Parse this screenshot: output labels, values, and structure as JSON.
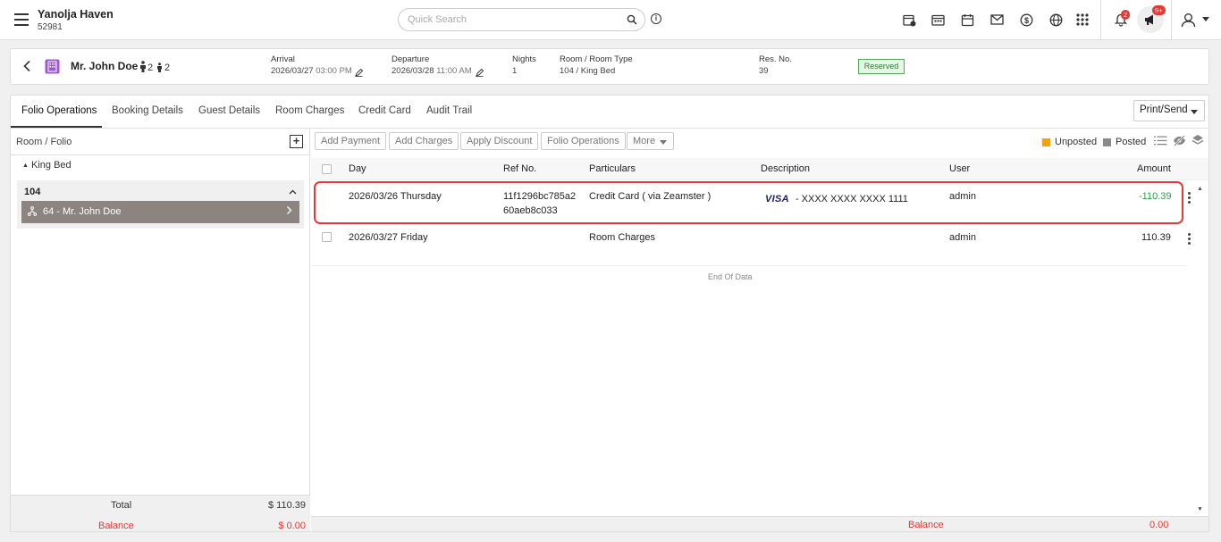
{
  "header": {
    "hotel_name": "Yanolja Haven",
    "hotel_id": "52981",
    "search_placeholder": "Quick Search",
    "notifications_badge": "2",
    "announcements_badge": "9+"
  },
  "reservation": {
    "guest_name": "Mr. John Doe",
    "adults": "2",
    "children": "2",
    "arrival_label": "Arrival",
    "arrival_date": "2026/03/27",
    "arrival_time": "03:00 PM",
    "departure_label": "Departure",
    "departure_date": "2026/03/28",
    "departure_time": "11:00 AM",
    "nights_label": "Nights",
    "nights": "1",
    "room_label": "Room / Room Type",
    "room_value": "104 / King Bed",
    "resno_label": "Res. No.",
    "resno": "39",
    "status": "Reserved"
  },
  "tabs": [
    "Folio Operations",
    "Booking Details",
    "Guest Details",
    "Room Charges",
    "Credit Card",
    "Audit Trail"
  ],
  "print_send": "Print/Send",
  "left": {
    "header": "Room / Folio",
    "group": "King Bed",
    "room": "104",
    "folio": "64 - Mr. John Doe",
    "total_label": "Total",
    "total_value": "$ 110.39",
    "balance_label": "Balance",
    "balance_value": "$ 0.00"
  },
  "actions": [
    "Add Payment",
    "Add Charges",
    "Apply Discount",
    "Folio Operations",
    "More"
  ],
  "legend": {
    "unposted": "Unposted",
    "posted": "Posted",
    "unposted_color": "#f0a30a",
    "posted_color": "#8a8a8a"
  },
  "columns": [
    "Day",
    "Ref No.",
    "Particulars",
    "Description",
    "User",
    "Amount"
  ],
  "rows": [
    {
      "day": "2026/03/26 Thursday",
      "ref1": "11f1296bc785a2",
      "ref2": "60aeb8c033",
      "particulars": "Credit Card ( via Zeamster )",
      "card_brand": "VISA",
      "description": "- XXXX XXXX XXXX 1111",
      "user": "admin",
      "amount": "-110.39"
    },
    {
      "day": "2026/03/27 Friday",
      "particulars": "Room Charges",
      "user": "admin",
      "amount": "110.39"
    }
  ],
  "end_of_data": "End Of Data",
  "footer": {
    "balance_label": "Balance",
    "balance_value": "0.00"
  }
}
